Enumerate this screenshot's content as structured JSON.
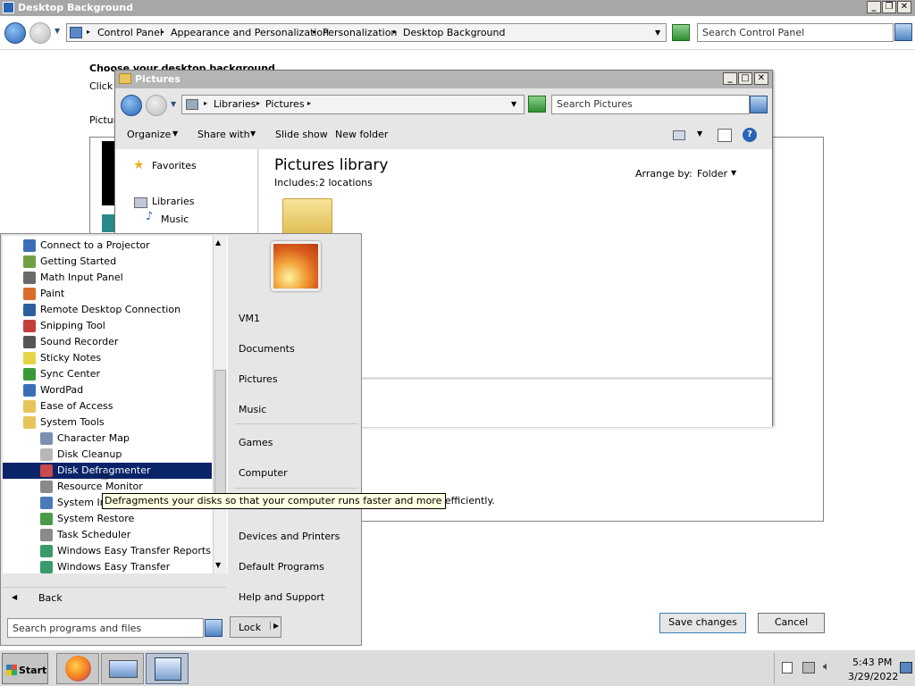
{
  "control_panel": {
    "title": "Desktop Background",
    "breadcrumb": [
      "Control Panel",
      "Appearance and Personalization",
      "Personalization",
      "Desktop Background"
    ],
    "search_placeholder": "Search Control Panel",
    "heading": "Choose your desktop background",
    "subtext": "Click a",
    "picture_label": "Pictur",
    "save_label": "Save changes",
    "cancel_label": "Cancel"
  },
  "pictures_window": {
    "title": "Pictures",
    "breadcrumb": [
      "Libraries",
      "Pictures"
    ],
    "search_placeholder": "Search Pictures",
    "toolbar": {
      "organize": "Organize",
      "share_with": "Share with",
      "slide_show": "Slide show",
      "new_folder": "New folder"
    },
    "nav": {
      "favorites": "Favorites",
      "libraries": "Libraries",
      "music": "Music"
    },
    "library_title": "Pictures library",
    "includes_label": "Includes:",
    "includes_value": "2 locations",
    "arrange_by_label": "Arrange by:",
    "arrange_by_value": "Folder"
  },
  "start_menu": {
    "programs": [
      {
        "label": "Connect to a Projector",
        "indent": false,
        "icon": "projector-icon",
        "color": "#3a6fb8"
      },
      {
        "label": "Getting Started",
        "indent": false,
        "icon": "getting-started-icon",
        "color": "#6fa046"
      },
      {
        "label": "Math Input Panel",
        "indent": false,
        "icon": "math-input-icon",
        "color": "#6a6a6a"
      },
      {
        "label": "Paint",
        "indent": false,
        "icon": "paint-icon",
        "color": "#d96c2a"
      },
      {
        "label": "Remote Desktop Connection",
        "indent": false,
        "icon": "remote-desktop-icon",
        "color": "#2e5e9e"
      },
      {
        "label": "Snipping Tool",
        "indent": false,
        "icon": "scissors-icon",
        "color": "#c43c3c"
      },
      {
        "label": "Sound Recorder",
        "indent": false,
        "icon": "microphone-icon",
        "color": "#555555"
      },
      {
        "label": "Sticky Notes",
        "indent": false,
        "icon": "sticky-notes-icon",
        "color": "#e7d347"
      },
      {
        "label": "Sync Center",
        "indent": false,
        "icon": "sync-icon",
        "color": "#3a9a3a"
      },
      {
        "label": "WordPad",
        "indent": false,
        "icon": "wordpad-icon",
        "color": "#3a6fb8"
      },
      {
        "label": "Ease of Access",
        "indent": false,
        "icon": "folder-icon",
        "color": "#e8c55a"
      },
      {
        "label": "System Tools",
        "indent": false,
        "icon": "folder-icon",
        "color": "#e8c55a"
      },
      {
        "label": "Character Map",
        "indent": true,
        "icon": "character-map-icon",
        "color": "#7b8fb0"
      },
      {
        "label": "Disk Cleanup",
        "indent": true,
        "icon": "disk-cleanup-icon",
        "color": "#b7b7b7"
      },
      {
        "label": "Disk Defragmenter",
        "indent": true,
        "icon": "defrag-icon",
        "color": "#c84a4a"
      },
      {
        "label": "Resource Monitor",
        "indent": true,
        "icon": "resource-monitor-icon",
        "color": "#8a8a8a"
      },
      {
        "label": "System Information",
        "indent": true,
        "icon": "system-info-icon",
        "color": "#4a7ab8"
      },
      {
        "label": "System Restore",
        "indent": true,
        "icon": "system-restore-icon",
        "color": "#4a9a4a"
      },
      {
        "label": "Task Scheduler",
        "indent": true,
        "icon": "clock-icon",
        "color": "#8a8a8a"
      },
      {
        "label": "Windows Easy Transfer Reports",
        "indent": true,
        "icon": "easy-transfer-icon",
        "color": "#3a9a6a"
      },
      {
        "label": "Windows Easy Transfer",
        "indent": true,
        "icon": "easy-transfer-icon",
        "color": "#3a9a6a"
      }
    ],
    "selected_index": 14,
    "back_label": "Back",
    "search_placeholder": "Search programs and files",
    "right_items": [
      "VM1",
      "Documents",
      "Pictures",
      "Music",
      "Games",
      "Computer",
      "Devices and Printers",
      "Default Programs",
      "Help and Support"
    ],
    "lock_label": "Lock"
  },
  "tooltip": "Defragments your disks so that your computer runs faster and more efficiently.",
  "taskbar": {
    "start_label": "Start",
    "time": "5:43 PM",
    "date": "3/29/2022"
  }
}
